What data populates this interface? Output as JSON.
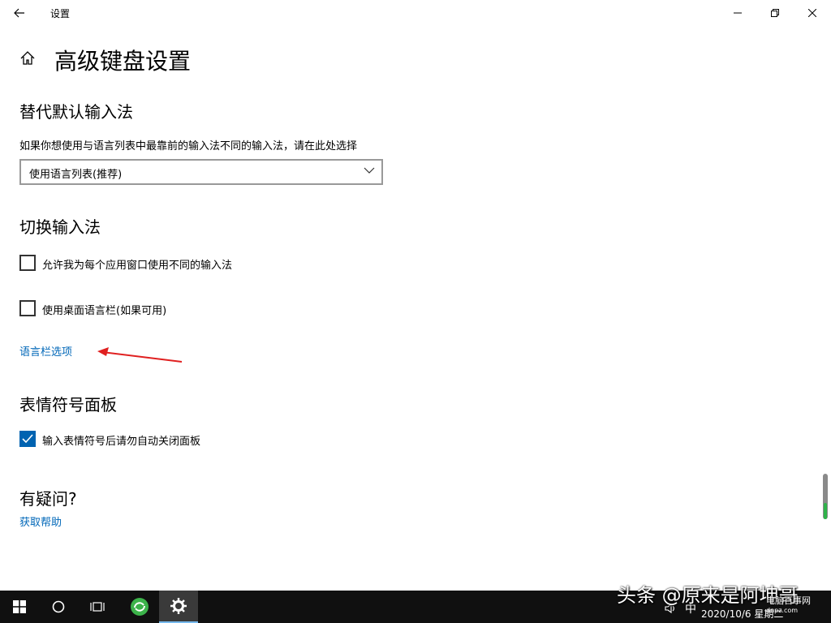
{
  "window": {
    "title": "设置"
  },
  "page": {
    "title": "高级键盘设置"
  },
  "sections": {
    "override": {
      "title": "替代默认输入法",
      "description": "如果你想使用与语言列表中最靠前的输入法不同的输入法，请在此处选择",
      "dropdown_value": "使用语言列表(推荐)"
    },
    "switch": {
      "title": "切换输入法",
      "checkbox1_label": "允许我为每个应用窗口使用不同的输入法",
      "checkbox1_checked": false,
      "checkbox2_label": "使用桌面语言栏(如果可用)",
      "checkbox2_checked": false,
      "link": "语言栏选项"
    },
    "emoji": {
      "title": "表情符号面板",
      "checkbox_label": "输入表情符号后请勿自动关闭面板",
      "checkbox_checked": true
    },
    "help": {
      "title": "有疑问?",
      "link": "获取帮助"
    }
  },
  "taskbar": {
    "ime": "中",
    "clock": "2020/10/6 星期二"
  },
  "watermark": {
    "text": "头条 @原来是阿坤哥",
    "site": "电脑百事网",
    "url": "dnpz.com"
  },
  "colors": {
    "accent": "#0067b8",
    "checkbox_checked": "#0063b1",
    "annotation_arrow": "#e02020",
    "taskbar": "#101010"
  },
  "icons": {
    "back": "back-arrow-icon",
    "minimize": "minimize-icon",
    "maximize": "restore-icon",
    "close": "close-icon",
    "home": "home-icon",
    "chevron": "chevron-down-icon",
    "check": "checkmark-icon",
    "start": "windows-logo-icon",
    "search": "search-circle-icon",
    "taskview": "task-view-icon",
    "browser": "browser-icon",
    "settings": "gear-icon",
    "volume": "volume-icon"
  }
}
